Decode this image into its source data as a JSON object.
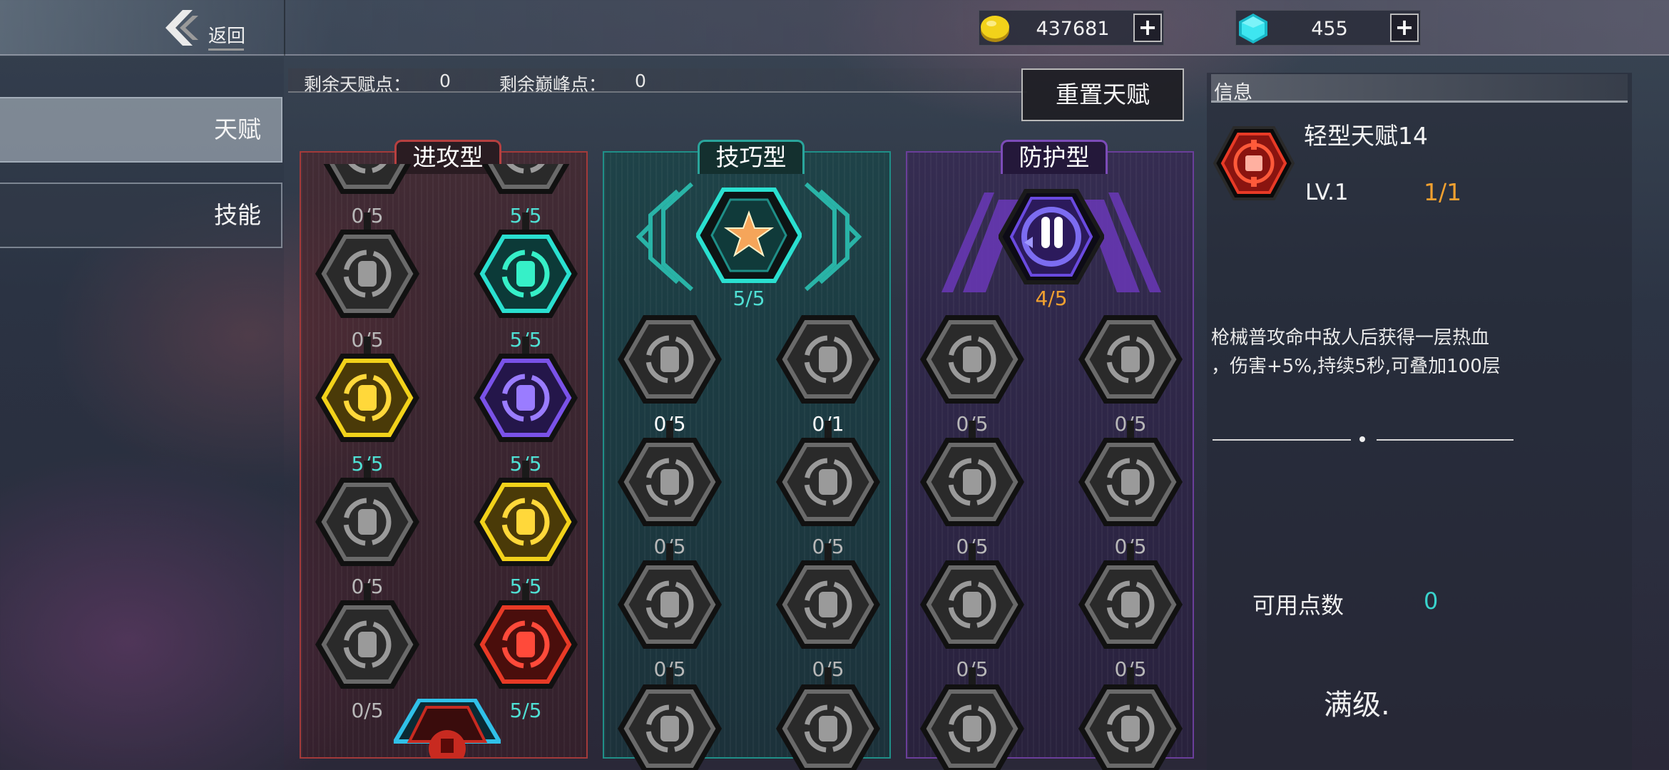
{
  "topbar": {
    "back_label": "返回",
    "gold": {
      "value": "437681",
      "icon": "gold-coin-icon",
      "plus": "+"
    },
    "gem": {
      "value": "455",
      "icon": "cyan-gem-icon",
      "plus": "+"
    }
  },
  "nav": [
    {
      "label": "天赋",
      "active": true
    },
    {
      "label": "技能",
      "active": false
    }
  ],
  "points": {
    "talent_label": "剩余天赋点：",
    "talent_value": "0",
    "peak_label": "剩余巅峰点：",
    "peak_value": "0",
    "reset_label": "重置天赋"
  },
  "columns": {
    "attack": {
      "title": "进攻型",
      "accent": "#b64040",
      "nodes": [
        {
          "icon": "partial-hex-icon",
          "count": "0/5"
        },
        {
          "icon": "partial-cyan-icon",
          "count": "5/5"
        },
        {
          "icon": "crossed-shields-icon",
          "count": "0/5"
        },
        {
          "icon": "cyan-claw-slash-icon",
          "count": "5/5"
        },
        {
          "icon": "yellow-bullet-burst-icon",
          "count": "5/5"
        },
        {
          "icon": "purple-wheel-icon",
          "count": "5/5"
        },
        {
          "icon": "double-bullet-icon",
          "count": "0/5"
        },
        {
          "icon": "yellow-bullet-lightning-icon",
          "count": "5/5"
        },
        {
          "icon": "grey-heart-gear-icon",
          "count": "0/5"
        },
        {
          "icon": "red-heart-bandage-icon",
          "count": "5/5"
        }
      ],
      "bottom_icon": "red-target-icon"
    },
    "skill": {
      "title": "技巧型",
      "accent": "#2aa59c",
      "top": {
        "icon": "orange-star-icon",
        "count": "5/5"
      },
      "nodes": [
        {
          "icon": "lightning-cycle-icon",
          "count": "0/5"
        },
        {
          "icon": "fast-boot-icon",
          "count": "0/1"
        },
        {
          "icon": "battery-cycle-icon",
          "count": "0/5"
        },
        {
          "icon": "gun-turret-icon",
          "count": "0/5"
        },
        {
          "icon": "gear-wheel-icon",
          "count": "0/5"
        },
        {
          "icon": "double-turret-icon",
          "count": "0/5"
        },
        {
          "icon": "gears-icon",
          "count": ""
        },
        {
          "icon": "turret-cycle-icon",
          "count": ""
        }
      ]
    },
    "defend": {
      "title": "防护型",
      "accent": "#7c4cb8",
      "top": {
        "icon": "purple-missile-cycle-icon",
        "count": "4/5"
      },
      "nodes": [
        {
          "icon": "rockets-icon",
          "count": "0/5"
        },
        {
          "icon": "shield-swirl-icon",
          "count": "0/5"
        },
        {
          "icon": "lightning-shield-icon",
          "count": "0/5"
        },
        {
          "icon": "rocket-shield-icon",
          "count": "0/5"
        },
        {
          "icon": "heart-cross-icon",
          "count": "0/5"
        },
        {
          "icon": "skull-shield-icon",
          "count": "0/5"
        },
        {
          "icon": "v-shield-icon",
          "count": ""
        },
        {
          "icon": "armor-icon",
          "count": ""
        }
      ]
    }
  },
  "info": {
    "header": "信息",
    "name": "轻型天赋14",
    "level": "LV.1",
    "progress": "1/1",
    "desc_line1": "枪械普攻命中敌人后获得一层热血",
    "desc_line2": "，伤害+5%,持续5秒,可叠加100层",
    "available_label": "可用点数",
    "available_value": "0",
    "status": "满级.",
    "icon": "red-target-icon"
  }
}
